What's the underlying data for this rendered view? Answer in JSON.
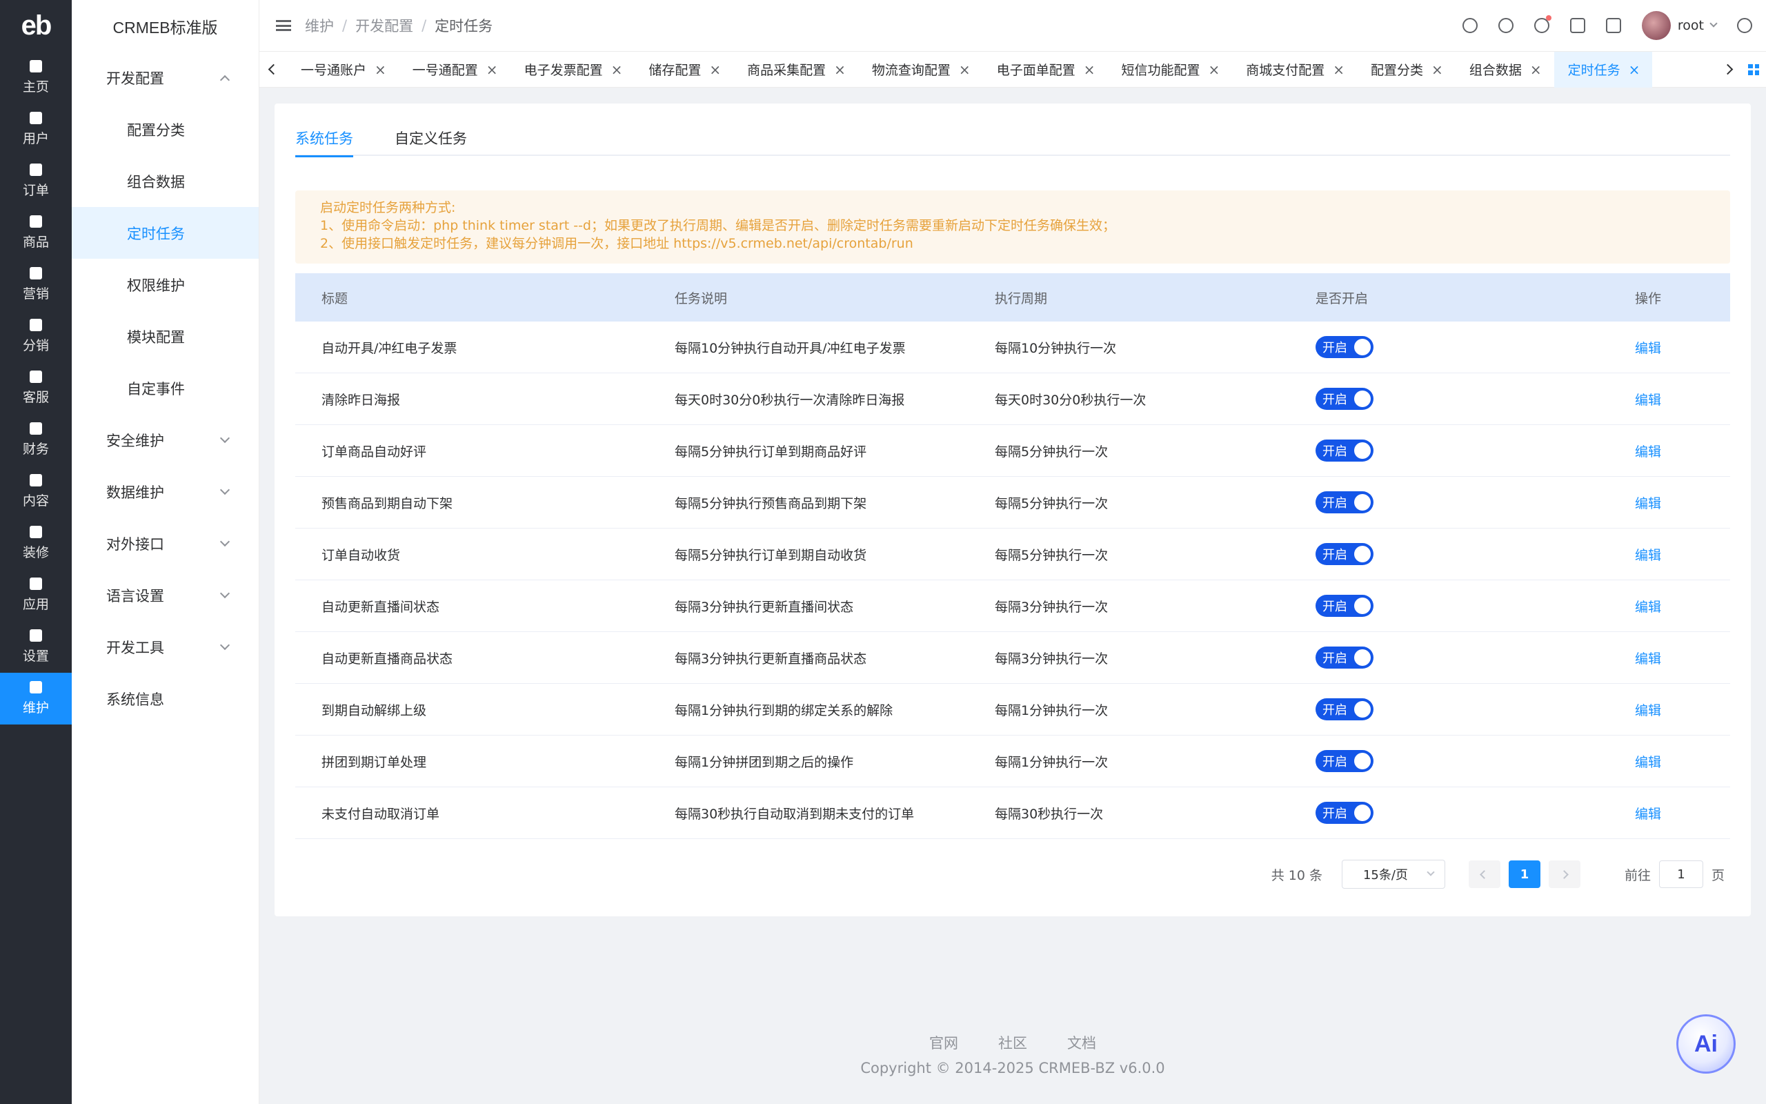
{
  "rail": {
    "logo": "eb",
    "items": [
      {
        "label": "主页",
        "icon": "home-icon"
      },
      {
        "label": "用户",
        "icon": "user-icon"
      },
      {
        "label": "订单",
        "icon": "order-icon"
      },
      {
        "label": "商品",
        "icon": "product-icon"
      },
      {
        "label": "营销",
        "icon": "marketing-icon"
      },
      {
        "label": "分销",
        "icon": "distribution-icon"
      },
      {
        "label": "客服",
        "icon": "service-icon"
      },
      {
        "label": "财务",
        "icon": "finance-icon"
      },
      {
        "label": "内容",
        "icon": "content-icon"
      },
      {
        "label": "装修",
        "icon": "decorate-icon"
      },
      {
        "label": "应用",
        "icon": "apps-icon"
      },
      {
        "label": "设置",
        "icon": "settings-icon"
      },
      {
        "label": "维护",
        "icon": "maintain-icon"
      }
    ]
  },
  "subnav": {
    "title": "CRMEB标准版",
    "group_dev": "开发配置",
    "items": [
      "配置分类",
      "组合数据",
      "定时任务",
      "权限维护",
      "模块配置",
      "自定事件"
    ],
    "groups": [
      "安全维护",
      "数据维护",
      "对外接口",
      "语言设置",
      "开发工具"
    ],
    "sysinfo": "系统信息"
  },
  "header": {
    "breadcrumb": [
      "维护",
      "开发配置",
      "定时任务"
    ],
    "username": "root"
  },
  "tabs": [
    "一号通账户",
    "一号通配置",
    "电子发票配置",
    "储存配置",
    "商品采集配置",
    "物流查询配置",
    "电子面单配置",
    "短信功能配置",
    "商城支付配置",
    "配置分类",
    "组合数据",
    "定时任务"
  ],
  "inner_tabs": [
    "系统任务",
    "自定义任务"
  ],
  "notice": {
    "line1": "启动定时任务两种方式:",
    "line2": "1、使用命令启动：php think timer start --d；如果更改了执行周期、编辑是否开启、删除定时任务需要重新启动下定时任务确保生效；",
    "line3": "2、使用接口触发定时任务，建议每分钟调用一次，接口地址 https://v5.crmeb.net/api/crontab/run"
  },
  "table": {
    "headers": [
      "标题",
      "任务说明",
      "执行周期",
      "是否开启",
      "操作"
    ],
    "switch_label": "开启",
    "edit_label": "编辑",
    "rows": [
      {
        "title": "自动开具/冲红电子发票",
        "desc": "每隔10分钟执行自动开具/冲红电子发票",
        "cycle": "每隔10分钟执行一次"
      },
      {
        "title": "清除昨日海报",
        "desc": "每天0时30分0秒执行一次清除昨日海报",
        "cycle": "每天0时30分0秒执行一次"
      },
      {
        "title": "订单商品自动好评",
        "desc": "每隔5分钟执行订单到期商品好评",
        "cycle": "每隔5分钟执行一次"
      },
      {
        "title": "预售商品到期自动下架",
        "desc": "每隔5分钟执行预售商品到期下架",
        "cycle": "每隔5分钟执行一次"
      },
      {
        "title": "订单自动收货",
        "desc": "每隔5分钟执行订单到期自动收货",
        "cycle": "每隔5分钟执行一次"
      },
      {
        "title": "自动更新直播间状态",
        "desc": "每隔3分钟执行更新直播间状态",
        "cycle": "每隔3分钟执行一次"
      },
      {
        "title": "自动更新直播商品状态",
        "desc": "每隔3分钟执行更新直播商品状态",
        "cycle": "每隔3分钟执行一次"
      },
      {
        "title": "到期自动解绑上级",
        "desc": "每隔1分钟执行到期的绑定关系的解除",
        "cycle": "每隔1分钟执行一次"
      },
      {
        "title": "拼团到期订单处理",
        "desc": "每隔1分钟拼团到期之后的操作",
        "cycle": "每隔1分钟执行一次"
      },
      {
        "title": "未支付自动取消订单",
        "desc": "每隔30秒执行自动取消到期未支付的订单",
        "cycle": "每隔30秒执行一次"
      }
    ]
  },
  "pagination": {
    "total": "共 10 条",
    "page_size": "15条/页",
    "current": "1",
    "goto_label": "前往",
    "goto_value": "1",
    "goto_suffix": "页"
  },
  "footer": {
    "links": [
      "官网",
      "社区",
      "文档"
    ],
    "copyright": "Copyright © 2014-2025 CRMEB-BZ v6.0.0"
  },
  "ai_button": "Ai",
  "colors": {
    "primary": "#1890ff",
    "rail_bg": "#282c34",
    "switch_on": "#1456e8",
    "notice_text": "#e6a23c"
  }
}
